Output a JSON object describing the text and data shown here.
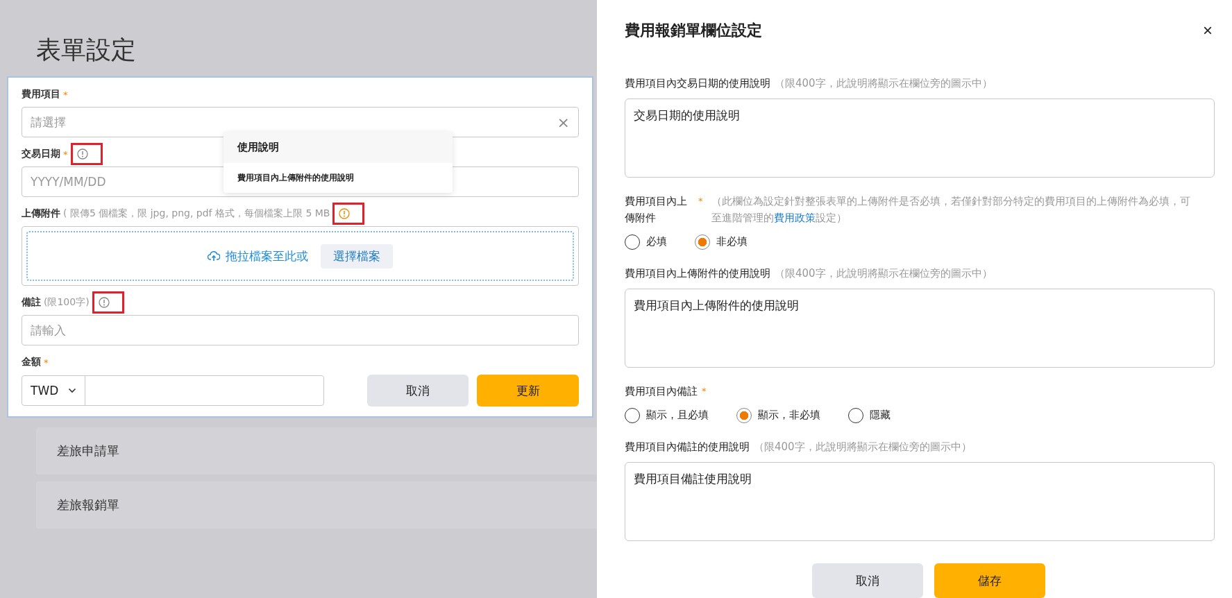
{
  "page": {
    "title": "表單設定",
    "list_items": [
      "差旅申請單",
      "差旅報銷單"
    ]
  },
  "form_card": {
    "fields": [
      {
        "kind": "select",
        "label": "費用項目",
        "required_mark": "*",
        "placeholder": "請選擇",
        "clear": "×"
      },
      {
        "kind": "date",
        "label": "交易日期",
        "required_mark": "*",
        "info": {
          "active": false,
          "annotated": true
        },
        "placeholder": "YYYY/MM/DD"
      },
      {
        "kind": "upload",
        "label": "上傳附件",
        "hint": "( 限傳5 個檔案，限 jpg, png, pdf 格式，每個檔案上限 5 MB",
        "info": {
          "active": true,
          "annotated": true
        },
        "drop_text": "拖拉檔案至此或",
        "button": "選擇檔案"
      },
      {
        "kind": "text",
        "label": "備註",
        "hint": "(限100字)",
        "info": {
          "active": false,
          "annotated": true
        },
        "placeholder": "請輸入"
      },
      {
        "kind": "amount",
        "label": "金額",
        "required_mark": "*",
        "currency": "TWD"
      }
    ],
    "buttons": [
      {
        "kind": "secondary",
        "label": "取消"
      },
      {
        "kind": "primary",
        "label": "更新"
      }
    ]
  },
  "tooltip": {
    "title": "使用說明",
    "text": "費用項目內上傳附件的使用說明"
  },
  "drawer": {
    "title": "費用報銷單欄位設定",
    "close": "×",
    "sections": [
      {
        "kind": "textarea",
        "label": "費用項目內交易日期的使用說明",
        "hint": "（限400字，此說明將顯示在欄位旁的圖示中）",
        "value": "交易日期的使用說明"
      },
      {
        "kind": "radio",
        "label": "費用項目內上傳附件",
        "required_mark": "*",
        "hint_before": "（此欄位為設定針對整張表單的上傳附件是否必填，若僅針對部分特定的費用項目的上傳附件為必填，可至進階管理的",
        "link": "費用政策",
        "hint_after": "設定）",
        "options": [
          {
            "label": "必填",
            "selected": false
          },
          {
            "label": "非必填",
            "selected": true
          }
        ]
      },
      {
        "kind": "textarea",
        "label": "費用項目內上傳附件的使用說明",
        "hint": "（限400字，此說明將顯示在欄位旁的圖示中）",
        "value": "費用項目內上傳附件的使用說明"
      },
      {
        "kind": "radio",
        "label": "費用項目內備註",
        "required_mark": "*",
        "options": [
          {
            "label": "顯示，且必填",
            "selected": false
          },
          {
            "label": "顯示，非必填",
            "selected": true
          },
          {
            "label": "隱藏",
            "selected": false
          }
        ]
      },
      {
        "kind": "textarea",
        "label": "費用項目內備註的使用說明",
        "hint": "（限400字，此說明將顯示在欄位旁的圖示中）",
        "value": "費用項目備註使用說明"
      }
    ],
    "buttons": [
      {
        "kind": "secondary",
        "label": "取消"
      },
      {
        "kind": "primary",
        "label": "儲存"
      }
    ]
  }
}
